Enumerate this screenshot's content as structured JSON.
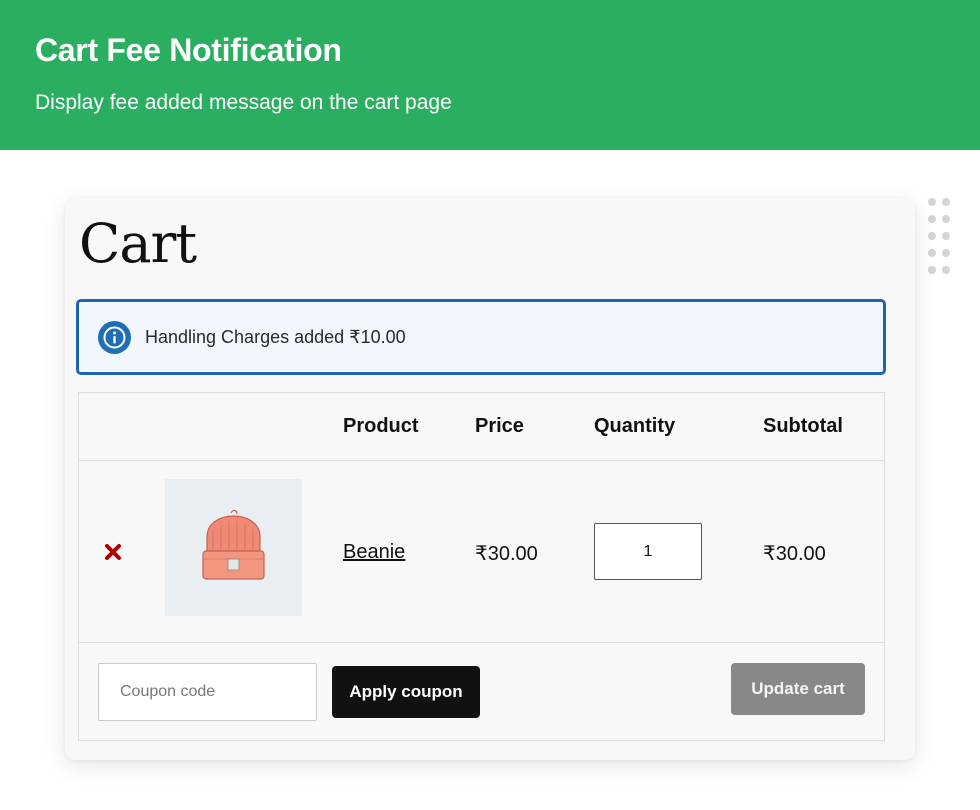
{
  "header": {
    "title": "Cart Fee Notification",
    "subtitle": "Display fee added message on the cart page",
    "background": "#2aaf60"
  },
  "cart": {
    "title": "Cart",
    "notice": {
      "icon": "info-icon",
      "text": "Handling Charges added ₹10.00",
      "accent": "#1e63b8"
    },
    "columns": {
      "product": "Product",
      "price": "Price",
      "quantity": "Quantity",
      "subtotal": "Subtotal"
    },
    "items": [
      {
        "remove_icon": "close-icon",
        "thumbnail_icon": "beanie-icon",
        "name": "Beanie",
        "price": "₹30.00",
        "quantity": "1",
        "subtotal": "₹30.00"
      }
    ],
    "coupon": {
      "placeholder": "Coupon code",
      "apply_label": "Apply coupon"
    },
    "update_label": "Update cart"
  }
}
